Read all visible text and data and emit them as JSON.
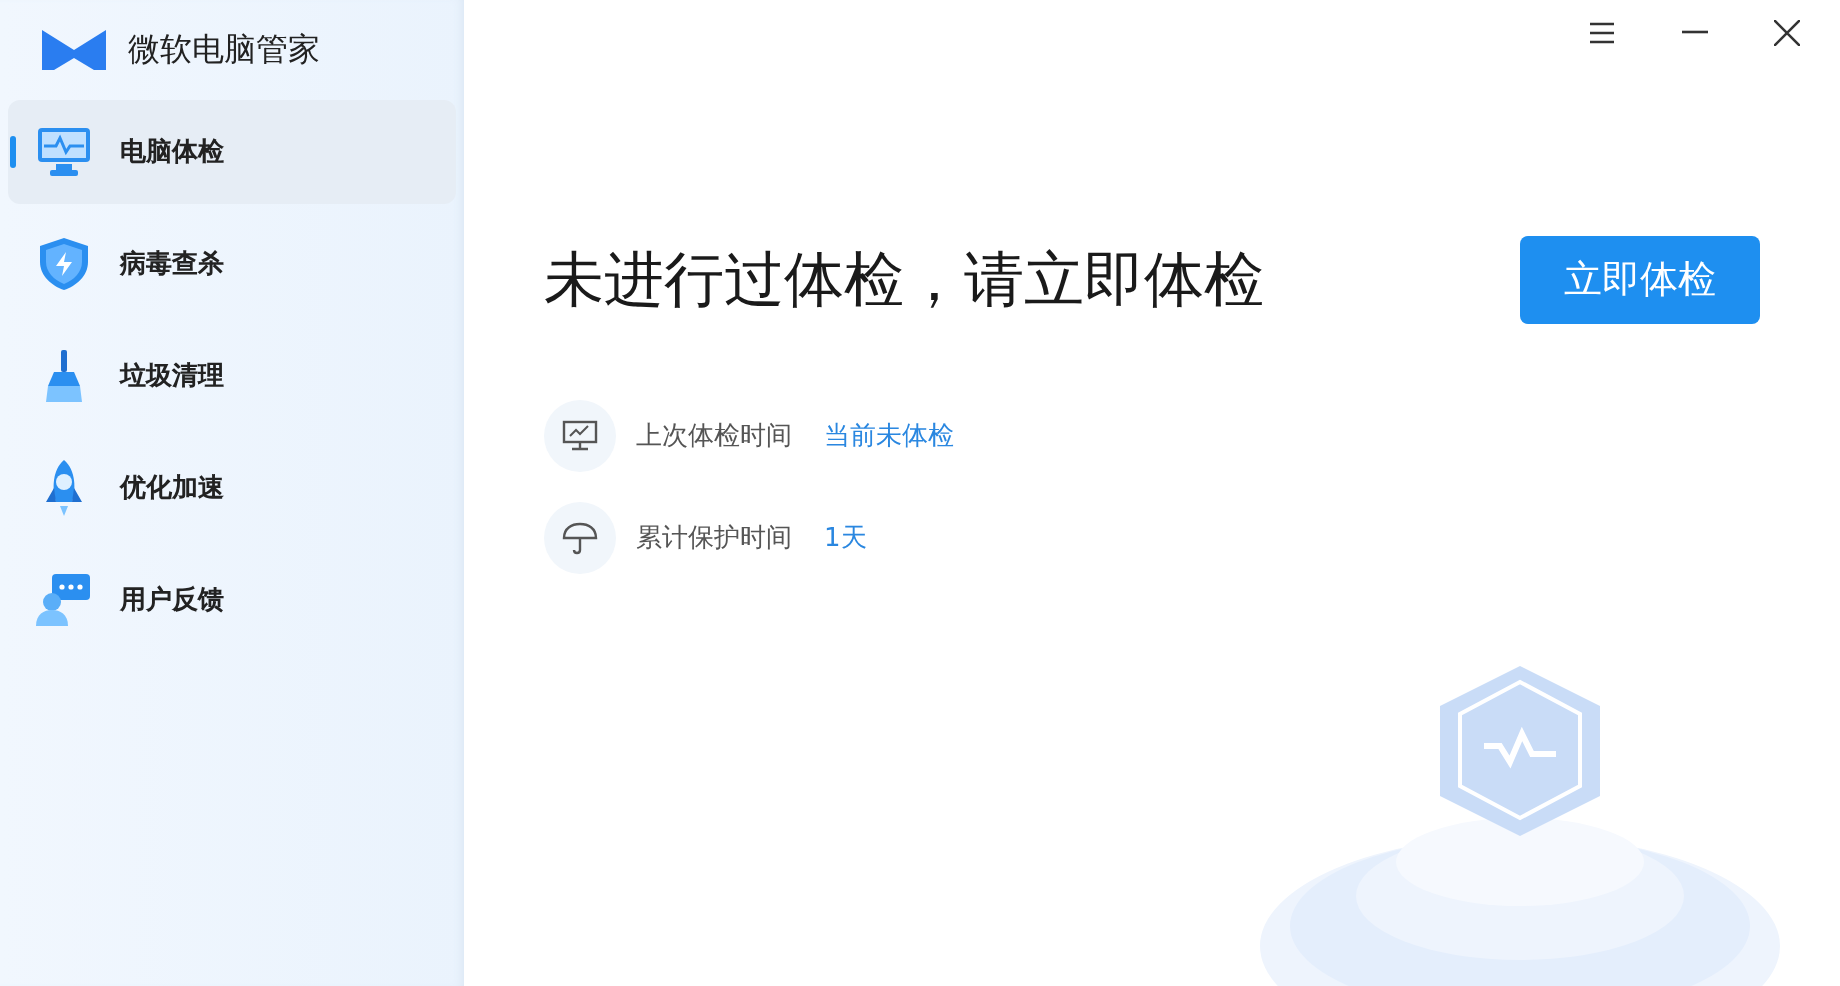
{
  "app": {
    "title": "微软电脑管家"
  },
  "sidebar": {
    "items": [
      {
        "label": "电脑体检",
        "selected": true
      },
      {
        "label": "病毒查杀",
        "selected": false
      },
      {
        "label": "垃圾清理",
        "selected": false
      },
      {
        "label": "优化加速",
        "selected": false
      },
      {
        "label": "用户反馈",
        "selected": false
      }
    ]
  },
  "main": {
    "heading": "未进行过体检，请立即体检",
    "action_button": "立即体检",
    "info_rows": [
      {
        "label": "上次体检时间",
        "value": "当前未体检"
      },
      {
        "label": "累计保护时间",
        "value": "1天"
      }
    ]
  }
}
